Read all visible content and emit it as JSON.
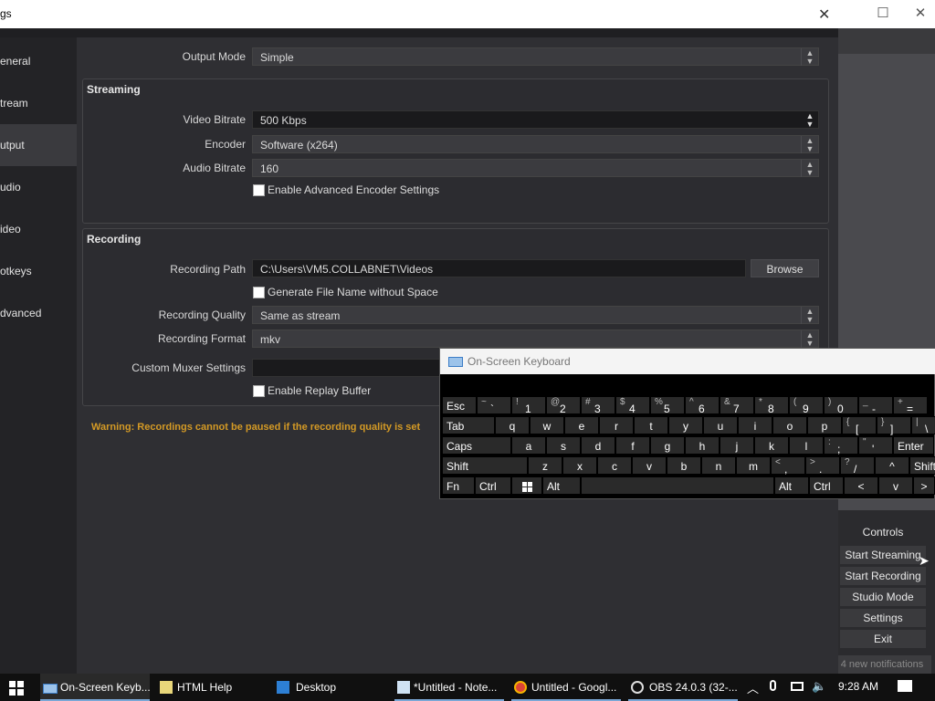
{
  "settings": {
    "title": "gs",
    "sidebar": [
      {
        "label": "eneral"
      },
      {
        "label": "tream"
      },
      {
        "label": "utput"
      },
      {
        "label": "udio"
      },
      {
        "label": "ideo"
      },
      {
        "label": "otkeys"
      },
      {
        "label": "dvanced"
      }
    ],
    "output_mode_label": "Output Mode",
    "output_mode_value": "Simple",
    "streaming": {
      "title": "Streaming",
      "video_bitrate_label": "Video Bitrate",
      "video_bitrate_value": "500 Kbps",
      "encoder_label": "Encoder",
      "encoder_value": "Software (x264)",
      "audio_bitrate_label": "Audio Bitrate",
      "audio_bitrate_value": "160",
      "advanced_label": "Enable Advanced Encoder Settings"
    },
    "recording": {
      "title": "Recording",
      "path_label": "Recording Path",
      "path_value": "C:\\Users\\VM5.COLLABNET\\Videos",
      "browse_label": "Browse",
      "gen_filename_label": "Generate File Name without Space",
      "quality_label": "Recording Quality",
      "quality_value": "Same as stream",
      "format_label": "Recording Format",
      "format_value": "mkv",
      "muxer_label": "Custom Muxer Settings",
      "replay_label": "Enable Replay Buffer"
    },
    "warning": "Warning: Recordings cannot be paused if the recording quality is set"
  },
  "obs": {
    "controls_title": "Controls",
    "buttons": [
      "Start Streaming",
      "Start Recording",
      "Studio Mode",
      "Settings",
      "Exit"
    ],
    "notifications": "4 new notifications"
  },
  "osk": {
    "title": "On-Screen Keyboard",
    "row1": [
      {
        "main": "Esc"
      },
      {
        "main": "`",
        "shift": "~"
      },
      {
        "main": "1",
        "shift": "!"
      },
      {
        "main": "2",
        "shift": "@"
      },
      {
        "main": "3",
        "shift": "#"
      },
      {
        "main": "4",
        "shift": "$"
      },
      {
        "main": "5",
        "shift": "%"
      },
      {
        "main": "6",
        "shift": "^"
      },
      {
        "main": "7",
        "shift": "&"
      },
      {
        "main": "8",
        "shift": "*"
      },
      {
        "main": "9",
        "shift": "("
      },
      {
        "main": "0",
        "shift": ")"
      },
      {
        "main": "-",
        "shift": "_"
      },
      {
        "main": "=",
        "shift": "+"
      }
    ],
    "row2": [
      "Tab",
      "q",
      "w",
      "e",
      "r",
      "t",
      "y",
      "u",
      "i",
      "o",
      "p",
      "[",
      "]",
      "\\"
    ],
    "row2_shift": [
      "",
      "",
      "",
      "",
      "",
      "",
      "",
      "",
      "",
      "",
      "",
      "{",
      "}",
      "|"
    ],
    "row3": [
      "Caps",
      "a",
      "s",
      "d",
      "f",
      "g",
      "h",
      "j",
      "k",
      "l",
      ";",
      "'",
      "Enter"
    ],
    "row3_shift": [
      "",
      "",
      "",
      "",
      "",
      "",
      "",
      "",
      "",
      "",
      ":",
      "\"",
      ""
    ],
    "row4": [
      "Shift",
      "z",
      "x",
      "c",
      "v",
      "b",
      "n",
      "m",
      ",",
      ".",
      "/",
      "^",
      "Shift"
    ],
    "row4_shift": [
      "",
      "",
      "",
      "",
      "",
      "",
      "",
      "",
      "<",
      ">",
      "?",
      "",
      ""
    ],
    "row5": [
      "Fn",
      "Ctrl",
      "",
      "Alt",
      "",
      "Alt",
      "Ctrl",
      "<",
      "v",
      ">"
    ]
  },
  "taskbar": {
    "items": [
      "On-Screen Keyb...",
      "HTML Help",
      "Desktop",
      "*Untitled - Note...",
      "Untitled - Googl...",
      "OBS 24.0.3 (32-..."
    ],
    "clock": "9:28 AM"
  }
}
